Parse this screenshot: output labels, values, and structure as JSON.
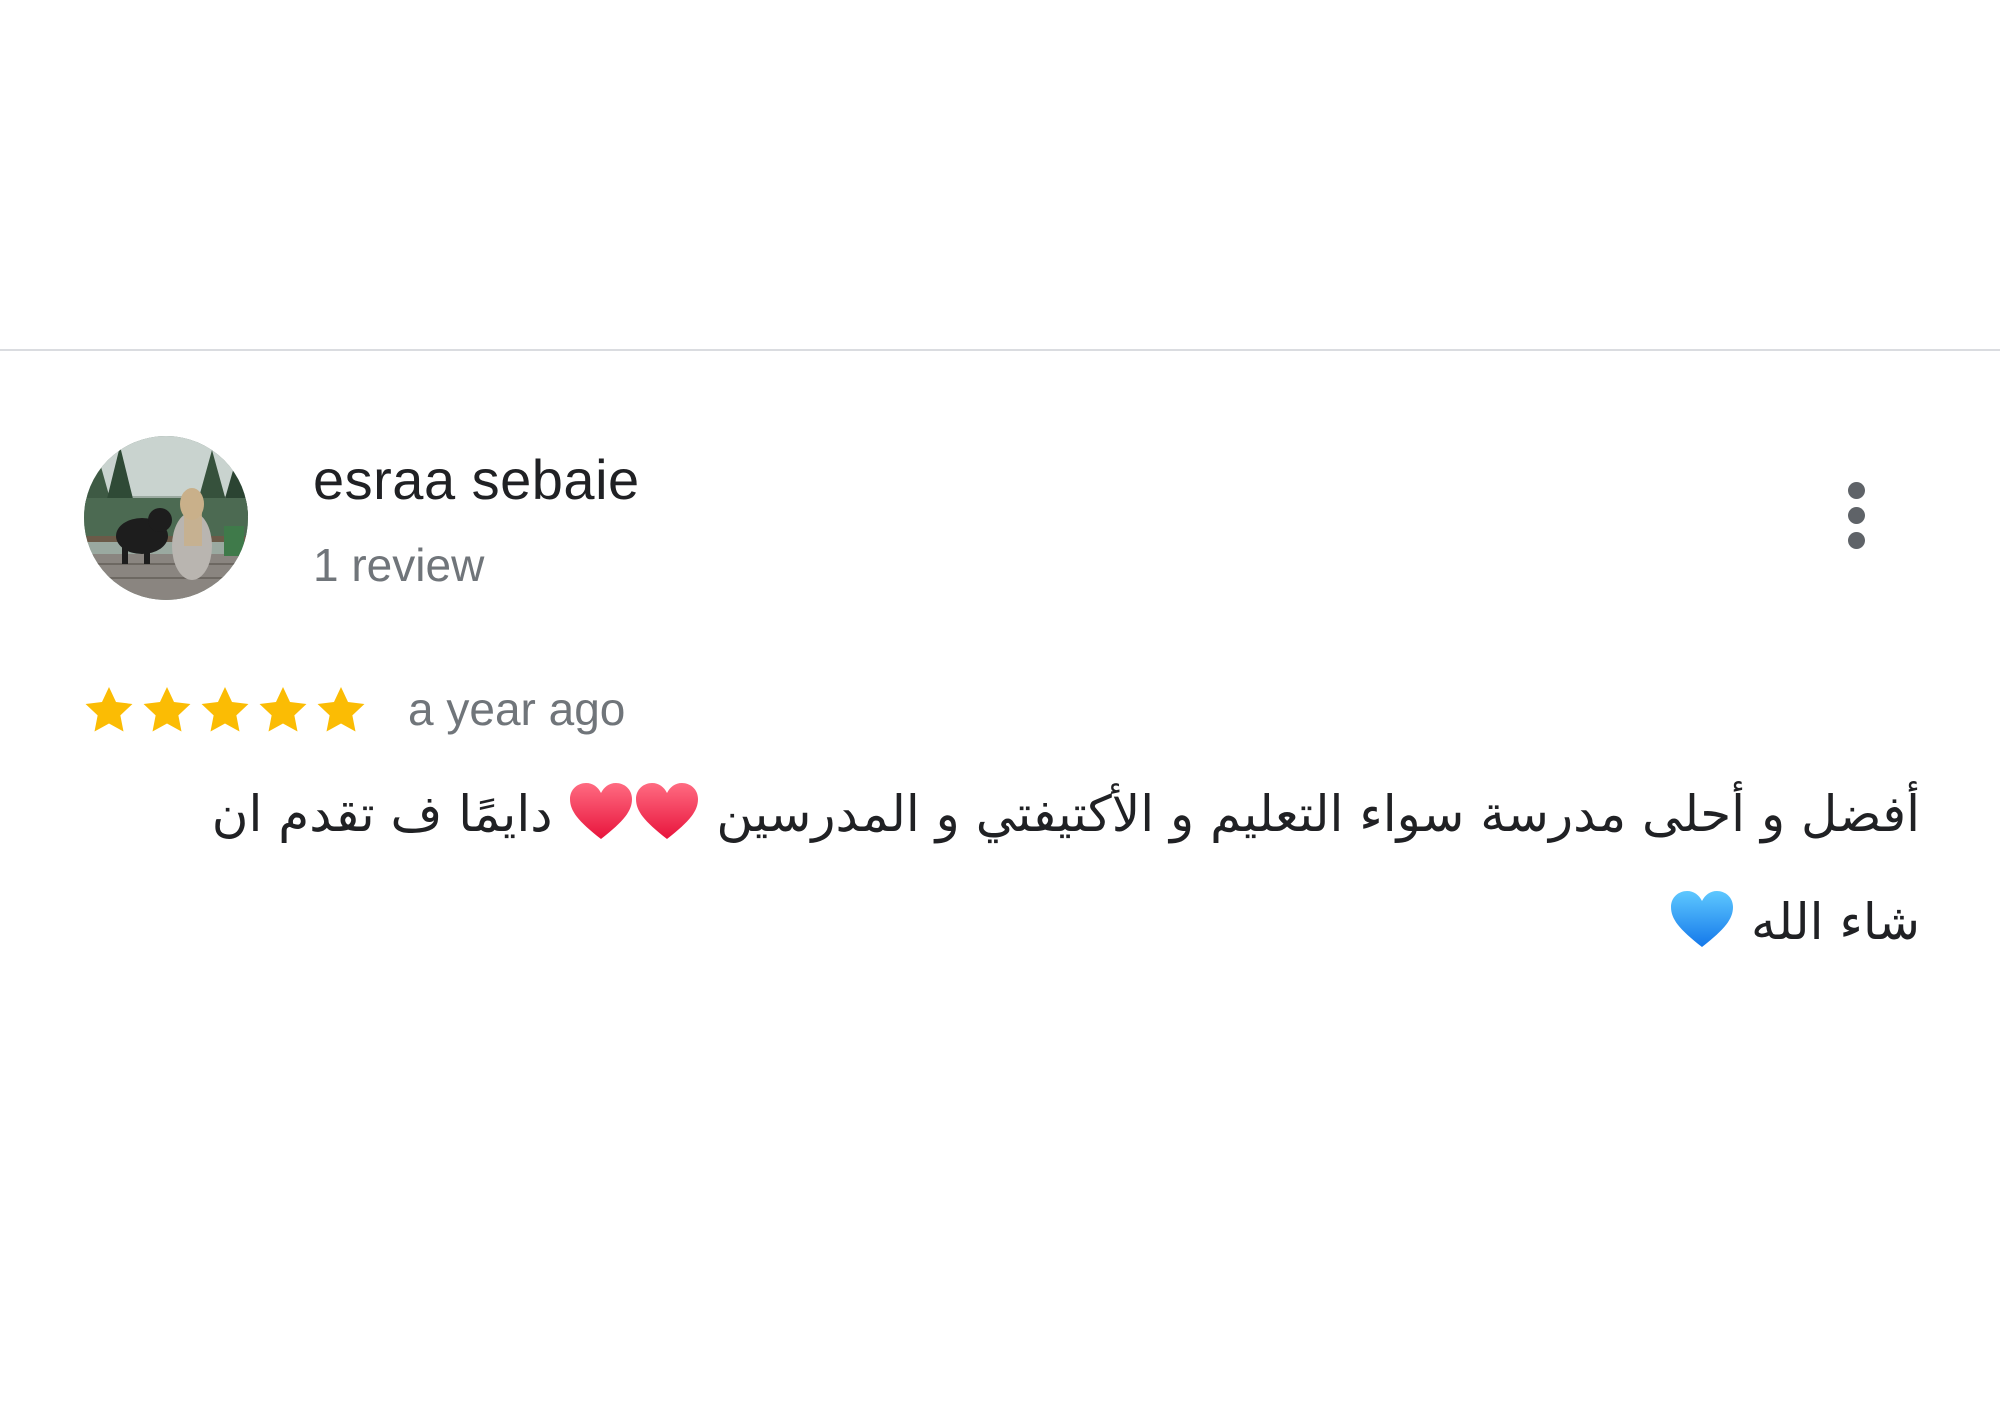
{
  "review": {
    "reviewer_name": "esraa sebaie",
    "reviewer_meta": "1 review",
    "rating": 5,
    "rating_max": 5,
    "time_ago": "a year ago",
    "text_line1_part1": "أفضل و أحلى مدرسة سواء التعليم و الأكتيفتي و المدرسين",
    "text_line1_part2": "دايمًا ف تقدم ان",
    "text_line2": "شاء الله",
    "emoji": [
      "red-heart-icon",
      "red-heart-icon",
      "blue-heart-icon"
    ]
  },
  "colors": {
    "star": "#fbbc04",
    "red_heart": "#f0304f",
    "blue_heart": "#1e90ff",
    "divider": "#dadce0",
    "secondary_text": "#70757a"
  },
  "actions": {
    "more_options_icon": "more-vertical-icon"
  }
}
